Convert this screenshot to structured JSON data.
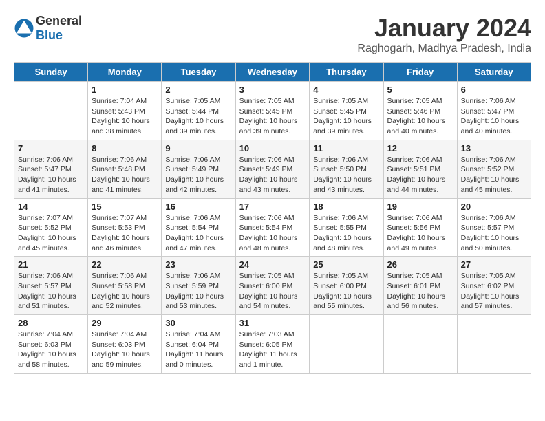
{
  "logo": {
    "text_general": "General",
    "text_blue": "Blue"
  },
  "title": "January 2024",
  "location": "Raghogarh, Madhya Pradesh, India",
  "days_of_week": [
    "Sunday",
    "Monday",
    "Tuesday",
    "Wednesday",
    "Thursday",
    "Friday",
    "Saturday"
  ],
  "weeks": [
    [
      {
        "day": "",
        "info": ""
      },
      {
        "day": "1",
        "info": "Sunrise: 7:04 AM\nSunset: 5:43 PM\nDaylight: 10 hours\nand 38 minutes."
      },
      {
        "day": "2",
        "info": "Sunrise: 7:05 AM\nSunset: 5:44 PM\nDaylight: 10 hours\nand 39 minutes."
      },
      {
        "day": "3",
        "info": "Sunrise: 7:05 AM\nSunset: 5:45 PM\nDaylight: 10 hours\nand 39 minutes."
      },
      {
        "day": "4",
        "info": "Sunrise: 7:05 AM\nSunset: 5:45 PM\nDaylight: 10 hours\nand 39 minutes."
      },
      {
        "day": "5",
        "info": "Sunrise: 7:05 AM\nSunset: 5:46 PM\nDaylight: 10 hours\nand 40 minutes."
      },
      {
        "day": "6",
        "info": "Sunrise: 7:06 AM\nSunset: 5:47 PM\nDaylight: 10 hours\nand 40 minutes."
      }
    ],
    [
      {
        "day": "7",
        "info": "Sunrise: 7:06 AM\nSunset: 5:47 PM\nDaylight: 10 hours\nand 41 minutes."
      },
      {
        "day": "8",
        "info": "Sunrise: 7:06 AM\nSunset: 5:48 PM\nDaylight: 10 hours\nand 41 minutes."
      },
      {
        "day": "9",
        "info": "Sunrise: 7:06 AM\nSunset: 5:49 PM\nDaylight: 10 hours\nand 42 minutes."
      },
      {
        "day": "10",
        "info": "Sunrise: 7:06 AM\nSunset: 5:49 PM\nDaylight: 10 hours\nand 43 minutes."
      },
      {
        "day": "11",
        "info": "Sunrise: 7:06 AM\nSunset: 5:50 PM\nDaylight: 10 hours\nand 43 minutes."
      },
      {
        "day": "12",
        "info": "Sunrise: 7:06 AM\nSunset: 5:51 PM\nDaylight: 10 hours\nand 44 minutes."
      },
      {
        "day": "13",
        "info": "Sunrise: 7:06 AM\nSunset: 5:52 PM\nDaylight: 10 hours\nand 45 minutes."
      }
    ],
    [
      {
        "day": "14",
        "info": "Sunrise: 7:07 AM\nSunset: 5:52 PM\nDaylight: 10 hours\nand 45 minutes."
      },
      {
        "day": "15",
        "info": "Sunrise: 7:07 AM\nSunset: 5:53 PM\nDaylight: 10 hours\nand 46 minutes."
      },
      {
        "day": "16",
        "info": "Sunrise: 7:06 AM\nSunset: 5:54 PM\nDaylight: 10 hours\nand 47 minutes."
      },
      {
        "day": "17",
        "info": "Sunrise: 7:06 AM\nSunset: 5:54 PM\nDaylight: 10 hours\nand 48 minutes."
      },
      {
        "day": "18",
        "info": "Sunrise: 7:06 AM\nSunset: 5:55 PM\nDaylight: 10 hours\nand 48 minutes."
      },
      {
        "day": "19",
        "info": "Sunrise: 7:06 AM\nSunset: 5:56 PM\nDaylight: 10 hours\nand 49 minutes."
      },
      {
        "day": "20",
        "info": "Sunrise: 7:06 AM\nSunset: 5:57 PM\nDaylight: 10 hours\nand 50 minutes."
      }
    ],
    [
      {
        "day": "21",
        "info": "Sunrise: 7:06 AM\nSunset: 5:57 PM\nDaylight: 10 hours\nand 51 minutes."
      },
      {
        "day": "22",
        "info": "Sunrise: 7:06 AM\nSunset: 5:58 PM\nDaylight: 10 hours\nand 52 minutes."
      },
      {
        "day": "23",
        "info": "Sunrise: 7:06 AM\nSunset: 5:59 PM\nDaylight: 10 hours\nand 53 minutes."
      },
      {
        "day": "24",
        "info": "Sunrise: 7:05 AM\nSunset: 6:00 PM\nDaylight: 10 hours\nand 54 minutes."
      },
      {
        "day": "25",
        "info": "Sunrise: 7:05 AM\nSunset: 6:00 PM\nDaylight: 10 hours\nand 55 minutes."
      },
      {
        "day": "26",
        "info": "Sunrise: 7:05 AM\nSunset: 6:01 PM\nDaylight: 10 hours\nand 56 minutes."
      },
      {
        "day": "27",
        "info": "Sunrise: 7:05 AM\nSunset: 6:02 PM\nDaylight: 10 hours\nand 57 minutes."
      }
    ],
    [
      {
        "day": "28",
        "info": "Sunrise: 7:04 AM\nSunset: 6:03 PM\nDaylight: 10 hours\nand 58 minutes."
      },
      {
        "day": "29",
        "info": "Sunrise: 7:04 AM\nSunset: 6:03 PM\nDaylight: 10 hours\nand 59 minutes."
      },
      {
        "day": "30",
        "info": "Sunrise: 7:04 AM\nSunset: 6:04 PM\nDaylight: 11 hours\nand 0 minutes."
      },
      {
        "day": "31",
        "info": "Sunrise: 7:03 AM\nSunset: 6:05 PM\nDaylight: 11 hours\nand 1 minute."
      },
      {
        "day": "",
        "info": ""
      },
      {
        "day": "",
        "info": ""
      },
      {
        "day": "",
        "info": ""
      }
    ]
  ]
}
